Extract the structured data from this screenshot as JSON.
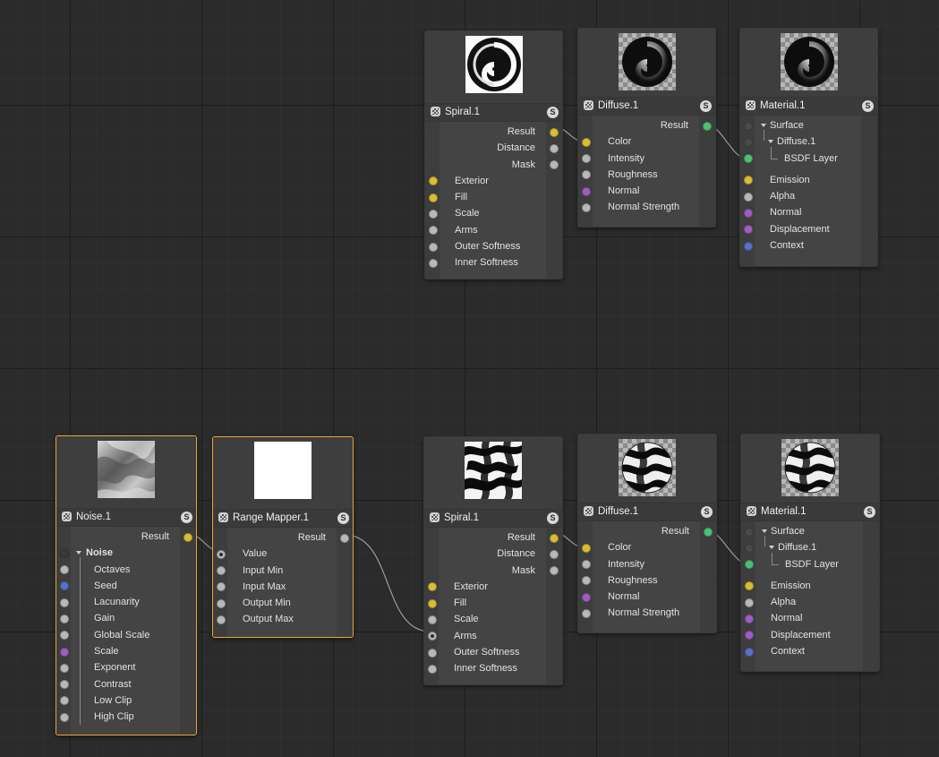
{
  "top_row": {
    "spiral": {
      "title": "Spiral.1",
      "outputs": [
        "Result",
        "Distance",
        "Mask"
      ],
      "inputs": [
        "Exterior",
        "Fill",
        "Scale",
        "Arms",
        "Outer Softness",
        "Inner Softness"
      ]
    },
    "diffuse": {
      "title": "Diffuse.1",
      "output": "Result",
      "inputs": [
        "Color",
        "Intensity",
        "Roughness",
        "Normal",
        "Normal Strength"
      ]
    },
    "material": {
      "title": "Material.1",
      "surface": "Surface",
      "diffuse_group": "Diffuse.1",
      "bsdf": "BSDF Layer",
      "inputs": [
        "Emission",
        "Alpha",
        "Normal",
        "Displacement",
        "Context"
      ]
    }
  },
  "bottom_row": {
    "noise": {
      "title": "Noise.1",
      "output": "Result",
      "group": "Noise",
      "params": [
        "Octaves",
        "Seed",
        "Lacunarity",
        "Gain",
        "Global Scale",
        "Scale",
        "Exponent",
        "Contrast",
        "Low Clip",
        "High Clip"
      ]
    },
    "range_mapper": {
      "title": "Range Mapper.1",
      "output": "Result",
      "inputs": [
        "Value",
        "Input Min",
        "Input Max",
        "Output Min",
        "Output Max"
      ]
    },
    "spiral": {
      "title": "Spiral.1",
      "outputs": [
        "Result",
        "Distance",
        "Mask"
      ],
      "inputs": [
        "Exterior",
        "Fill",
        "Scale",
        "Arms",
        "Outer Softness",
        "Inner Softness"
      ]
    },
    "diffuse": {
      "title": "Diffuse.1",
      "output": "Result",
      "inputs": [
        "Color",
        "Intensity",
        "Roughness",
        "Normal",
        "Normal Strength"
      ]
    },
    "material": {
      "title": "Material.1",
      "surface": "Surface",
      "diffuse_group": "Diffuse.1",
      "bsdf": "BSDF Layer",
      "inputs": [
        "Emission",
        "Alpha",
        "Normal",
        "Displacement",
        "Context"
      ]
    }
  },
  "solo_label": "S",
  "colors": {
    "canvas": "#2b2b2b",
    "node": "#444444",
    "selected_border": "#e8a932",
    "port_color": "#d9be34",
    "port_grey": "#b8b8b8",
    "port_bsdf": "#4cc175",
    "port_normal": "#9b5fc0",
    "port_context": "#5871c8"
  }
}
